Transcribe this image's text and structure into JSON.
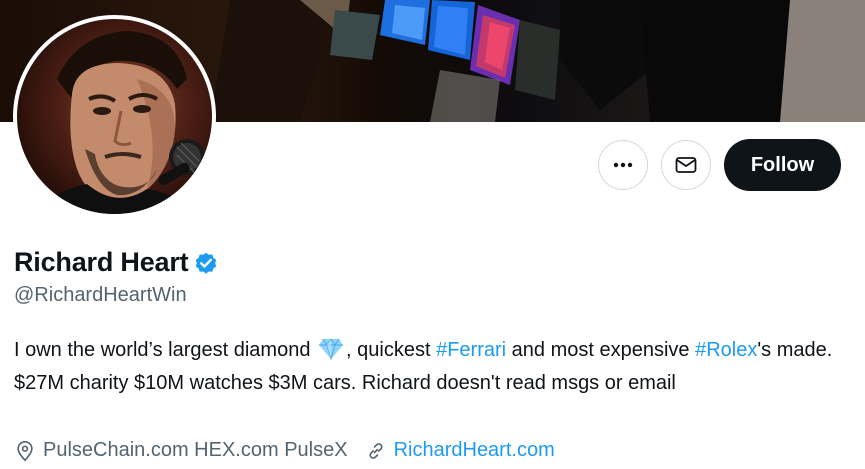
{
  "profile": {
    "display_name": "Richard Heart",
    "handle": "@RichardHeartWin",
    "verified_icon": "verified-badge-icon"
  },
  "actions": {
    "more_icon": "more-icon",
    "message_icon": "mail-icon",
    "follow_label": "Follow"
  },
  "bio": {
    "part1": "I own the world’s largest diamond",
    "diamond_icon": "diamond-emoji",
    "part2": ", quickest ",
    "tag_ferrari": "#Ferrari",
    "part3": " and most expensive ",
    "tag_rolex": "#Rolex",
    "part4": "'s made. $27M charity $10M watches $3M cars. Richard doesn't read msgs or email"
  },
  "meta": {
    "location_icon": "location-icon",
    "location": "PulseChain.com HEX.com PulseX",
    "link_icon": "link-icon",
    "website": "RichardHeart.com"
  },
  "colors": {
    "accent": "#1d9bf0",
    "text": "#0f1419",
    "secondary": "#536471",
    "border": "#cfd9de"
  }
}
